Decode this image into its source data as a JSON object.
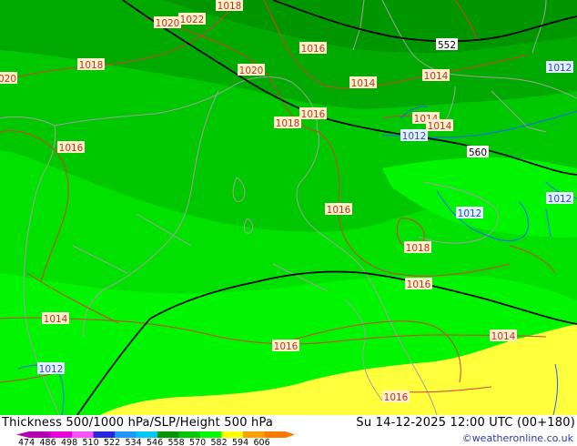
{
  "footer": {
    "title": "Thickness 500/1000 hPa/SLP/Height 500 hPa",
    "datetime": "Su 14-12-2025 12:00 UTC (00+180)",
    "credit": "©weatheronline.co.uk"
  },
  "legend": {
    "items": [
      {
        "label": "474",
        "color": "#b400b4"
      },
      {
        "label": "486",
        "color": "#e600dc"
      },
      {
        "label": "498",
        "color": "#ff50ff"
      },
      {
        "label": "510",
        "color": "#2828dc"
      },
      {
        "label": "522",
        "color": "#1e96ff"
      },
      {
        "label": "534",
        "color": "#00c8ff"
      },
      {
        "label": "546",
        "color": "#009600"
      },
      {
        "label": "558",
        "color": "#00c800"
      },
      {
        "label": "570",
        "color": "#00ff00"
      },
      {
        "label": "582",
        "color": "#ffff00"
      },
      {
        "label": "594",
        "color": "#ffa000"
      },
      {
        "label": "606",
        "color": "#ff7800"
      }
    ]
  },
  "map": {
    "fill_colors": {
      "band_darkest": "#009600",
      "band_dark": "#00aa00",
      "band_mid": "#00c800",
      "band_bright": "#00e100",
      "band_lightest": "#00f500",
      "band_yellow": "#ffff3c"
    },
    "line_colors": {
      "isobar_high": "#d04030",
      "isobar_low": "#1e60ff",
      "height_500": "#000000",
      "coast": "#a0a0a0"
    },
    "height_labels": [
      "552",
      "560"
    ],
    "isobar_labels": [
      "1018",
      "1022",
      "1020",
      "020",
      "1018",
      "1016",
      "1020",
      "1014",
      "1014",
      "1016",
      "1018",
      "1014",
      "1014",
      "1016",
      "1016",
      "1018",
      "1016",
      "1016",
      "1014",
      "1016",
      "1014",
      "1016"
    ],
    "isobar_labels_blue": [
      "1012",
      "1012",
      "1012",
      "1012",
      "1012"
    ]
  }
}
